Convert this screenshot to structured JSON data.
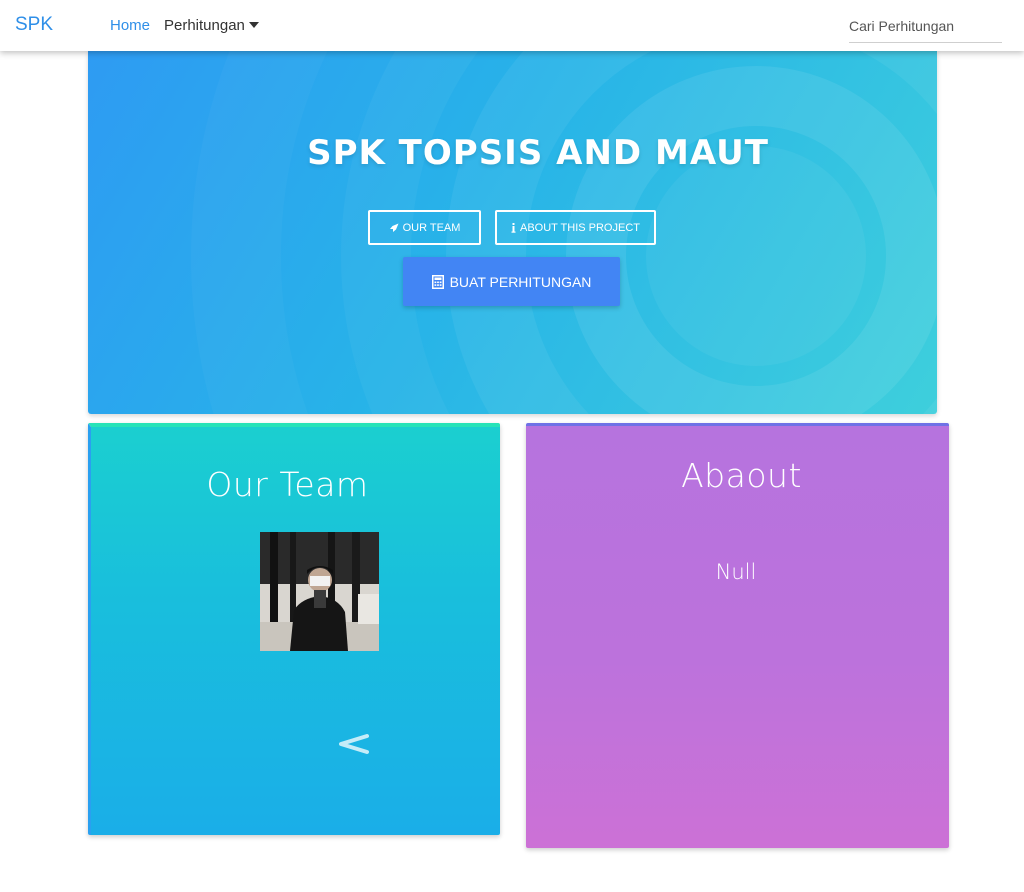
{
  "navbar": {
    "brand": "SPK",
    "home": "Home",
    "perhitungan": "Perhitungan",
    "search_placeholder": "Cari Perhitungan"
  },
  "hero": {
    "title": "SPK TOPSIS AND MAUT",
    "our_team_button": "OUR TEAM",
    "about_button": "ABOUT THIS PROJECT",
    "create_button": "BUAT PERHITUNGAN"
  },
  "team": {
    "title": "Our Team",
    "prev_icon": "chevron-left-icon"
  },
  "about": {
    "title": "Abaout",
    "text": "Null"
  },
  "colors": {
    "brand": "#2f8fe8",
    "primary_button": "#4285f4",
    "team_card": "#19bfdc",
    "about_card": "#bc72dc"
  },
  "icons": [
    "rocket-icon",
    "info-icon",
    "calculator-icon",
    "chevron-left-icon"
  ]
}
